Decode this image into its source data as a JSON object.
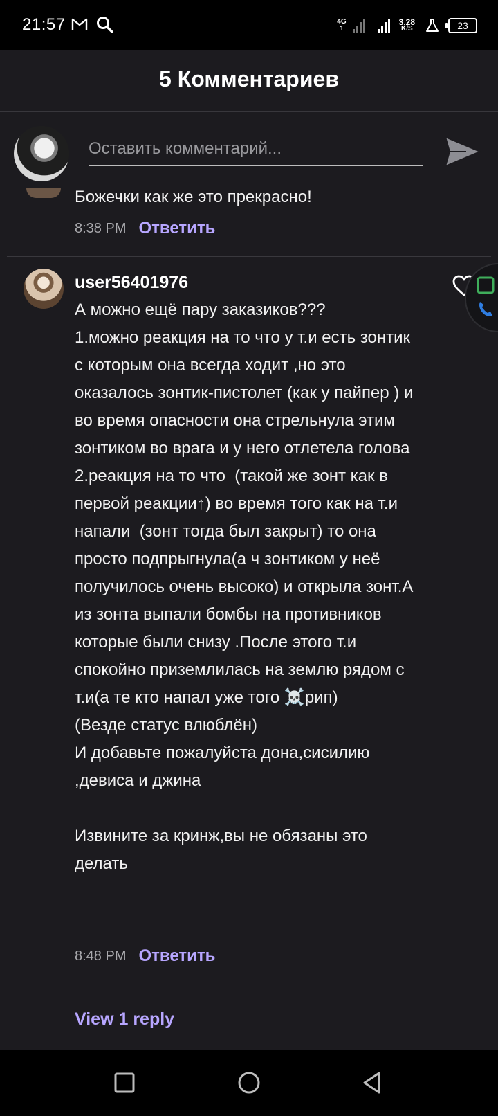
{
  "status_bar": {
    "time": "21:57",
    "network": "4G",
    "sim": "1",
    "speed_value": "3,28",
    "speed_unit": "K/S",
    "battery": "23"
  },
  "header": {
    "title": "5 Комментариев"
  },
  "composer": {
    "placeholder": "Оставить комментарий..."
  },
  "comments": [
    {
      "text": "Божечки как же это прекрасно!",
      "time": "8:38 PM",
      "reply_label": "Ответить"
    },
    {
      "username": "user56401976",
      "text": "А можно ещё пару заказиков???\n1.можно реакция на то что у т.и есть зонтик с которым она всегда ходит ,но это оказалось зонтик-пистолет (как у пайпер ) и во время опасности она стрельнула этим зонтиком во врага и у него отлетела голова\n2.реакция на то что  (такой же зонт как в первой реакции↑) во время того как на т.и напали  (зонт тогда был закрыт) то она просто подпрыгнула(а ч зонтиком у неё получилось очень высоко) и открыла зонт.А из зонта выпали бомбы на противников которые были снизу .После этого т.и спокойно приземлилась на землю рядом с т.и(а те кто напал уже того ☠️рип)\n(Везде статус влюблён)\nИ добавьте пожалуйста дона,сисилию ,девиса и джина\n\nИзвините за кринж,вы не обязаны это делать",
      "time": "8:48 PM",
      "reply_label": "Ответить",
      "view_replies": "View 1 reply"
    }
  ],
  "colors": {
    "background": "#1c1b1f",
    "accent": "#b7a6ff",
    "text": "#f2f2f2",
    "muted": "#a9a9ad"
  }
}
